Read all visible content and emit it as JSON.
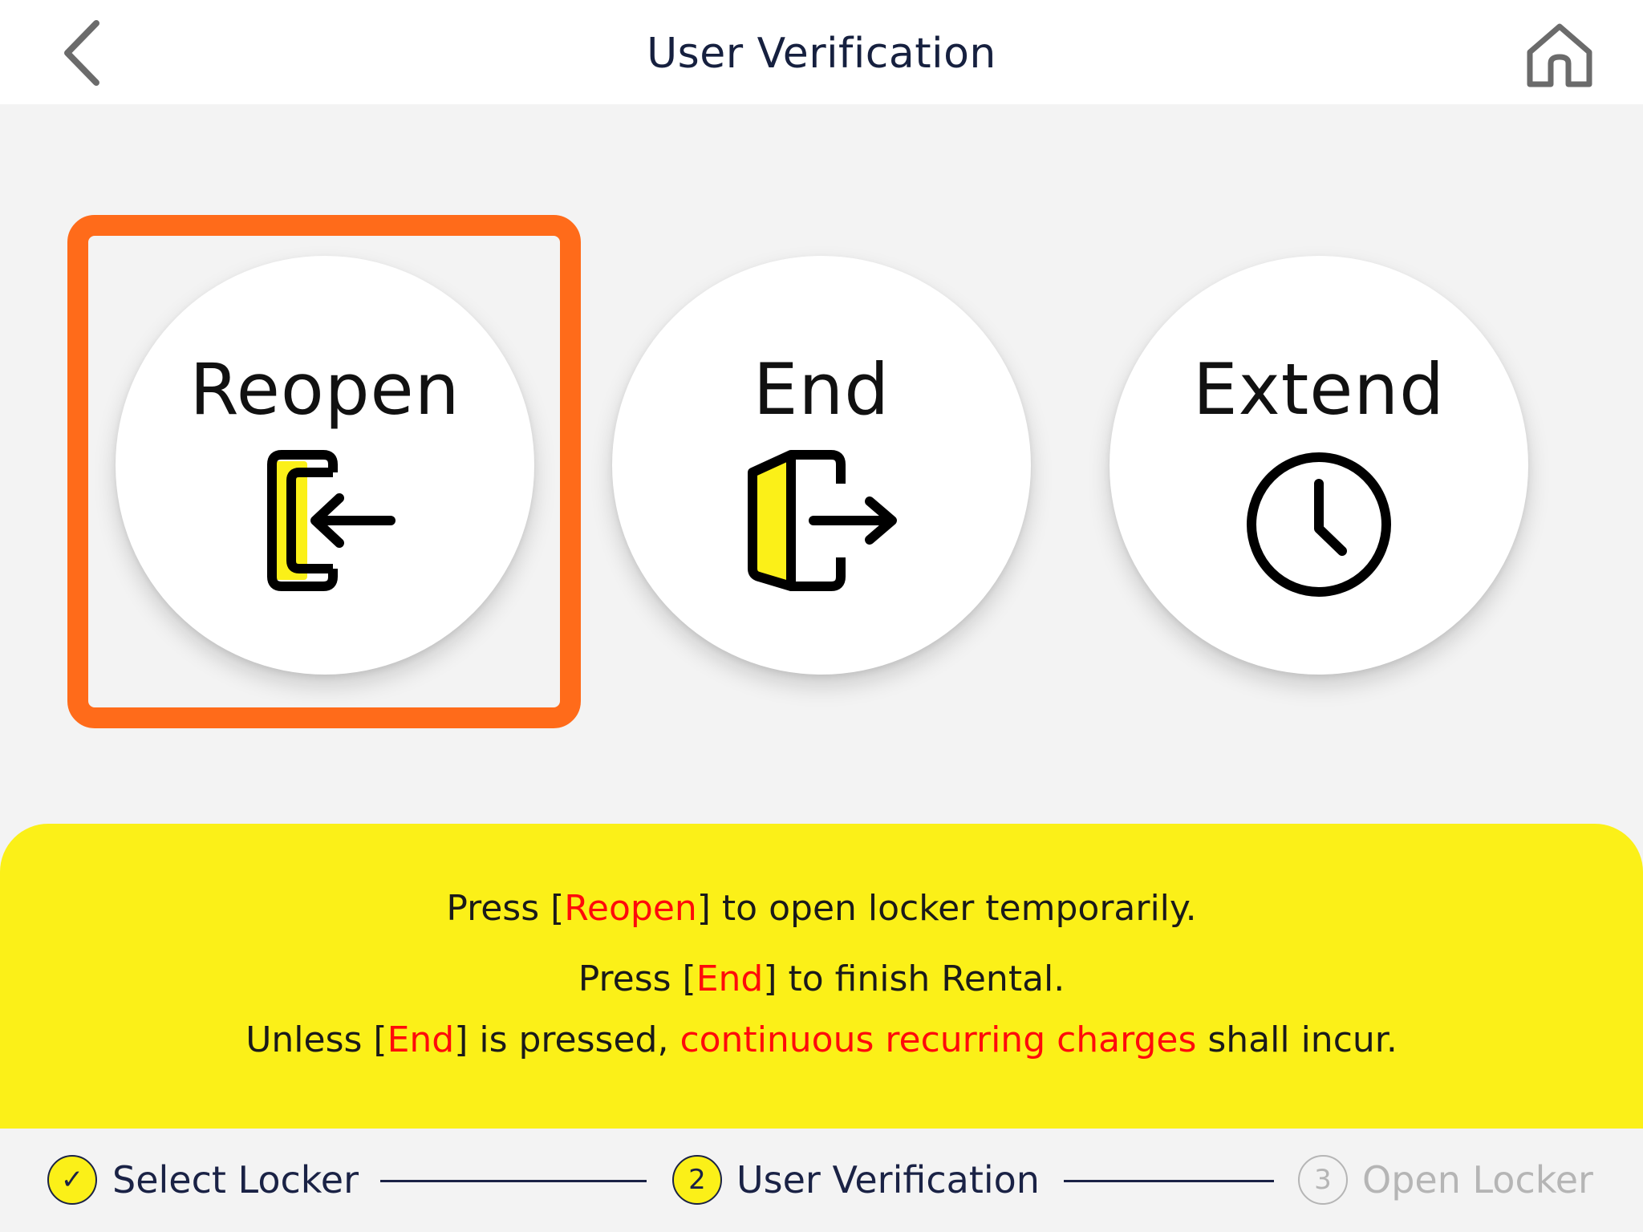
{
  "header": {
    "title": "User Verification",
    "back_icon": "chevron-left-icon",
    "home_icon": "home-icon"
  },
  "options": [
    {
      "label": "Reopen",
      "icon": "door-enter-icon",
      "selected": true
    },
    {
      "label": "End",
      "icon": "door-exit-icon",
      "selected": false
    },
    {
      "label": "Extend",
      "icon": "clock-icon",
      "selected": false
    }
  ],
  "notice": {
    "line1": {
      "pre": "Press [",
      "hl": "Reopen",
      "post": "] to open locker temporarily."
    },
    "line2": {
      "pre": "Press [",
      "hl": "End",
      "post": "] to finish Rental."
    },
    "line3": {
      "pre": "Unless [",
      "hl": "End",
      "mid": "] is pressed, ",
      "hl2": "continuous recurring charges",
      "post": " shall incur."
    }
  },
  "steps": [
    {
      "marker": "✓",
      "label": "Select Locker",
      "state": "done"
    },
    {
      "marker": "2",
      "label": "User Verification",
      "state": "current"
    },
    {
      "marker": "3",
      "label": "Open Locker",
      "state": "pending"
    }
  ],
  "colors": {
    "accent_yellow": "#fbf018",
    "selection_orange": "#ff6b1a",
    "highlight_red": "#ff0a0a",
    "title_navy": "#16203f",
    "pending_gray": "#b5b5b5"
  }
}
